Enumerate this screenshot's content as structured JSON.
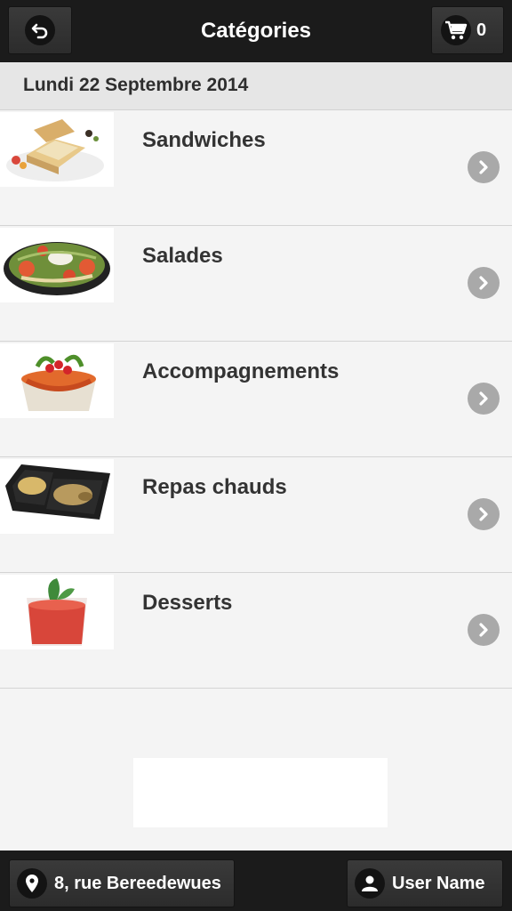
{
  "header": {
    "title": "Catégories",
    "back_icon": "undo-arrow-icon",
    "cart_icon": "cart-icon",
    "cart_count": "0"
  },
  "date_bar": {
    "text": "Lundi 22 Septembre 2014"
  },
  "categories": [
    {
      "label": "Sandwiches",
      "image": "sandwich-photo"
    },
    {
      "label": "Salades",
      "image": "salad-photo"
    },
    {
      "label": "Accompagnements",
      "image": "side-dish-photo"
    },
    {
      "label": "Repas chauds",
      "image": "hot-meal-photo"
    },
    {
      "label": "Desserts",
      "image": "dessert-photo"
    }
  ],
  "footer": {
    "address": "8, rue Bereedewues",
    "address_icon": "location-pin-icon",
    "user_name": "User Name",
    "user_icon": "user-icon"
  },
  "colors": {
    "header_bg": "#1b1b1b",
    "page_bg": "#f4f4f4",
    "date_bar_bg": "#e6e6e6",
    "chevron_bg": "#a9a9a9",
    "text_dark": "#333333"
  }
}
